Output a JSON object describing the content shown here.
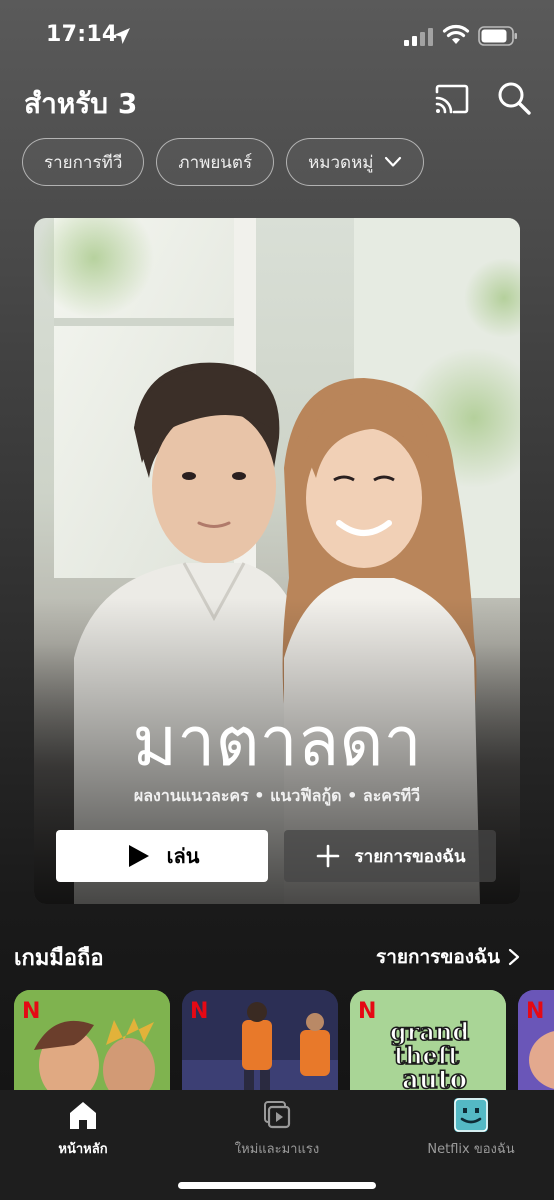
{
  "status": {
    "time": "17:14"
  },
  "header": {
    "title": "สำหรับ 3"
  },
  "chips": [
    {
      "label": "รายการทีวี"
    },
    {
      "label": "ภาพยนตร์"
    },
    {
      "label": "หมวดหมู่"
    }
  ],
  "hero": {
    "title": "มาตาลดา",
    "tags": "ผลงานแนวละคร • แนวฟีลกู้ด • ละครทีวี",
    "play_label": "เล่น",
    "list_label": "รายการของฉัน"
  },
  "games_row": {
    "title": "เกมมือถือ",
    "link_label": "รายการของฉัน",
    "tiles": [
      {
        "name": "game-1",
        "color": "#7ab24a"
      },
      {
        "name": "game-2",
        "color": "#2a2f4d"
      },
      {
        "name": "gta",
        "color": "#9fcf8e"
      },
      {
        "name": "game-4",
        "color": "#5a4fb0"
      }
    ]
  },
  "nav": {
    "items": [
      {
        "label": "หน้าหลัก",
        "active": true
      },
      {
        "label": "ใหม่และมาแรง",
        "active": false
      },
      {
        "label": "Netflix ของฉัน",
        "active": false
      }
    ]
  },
  "colors": {
    "netflix_red": "#e50914",
    "accent_teal": "#54b9c5"
  }
}
